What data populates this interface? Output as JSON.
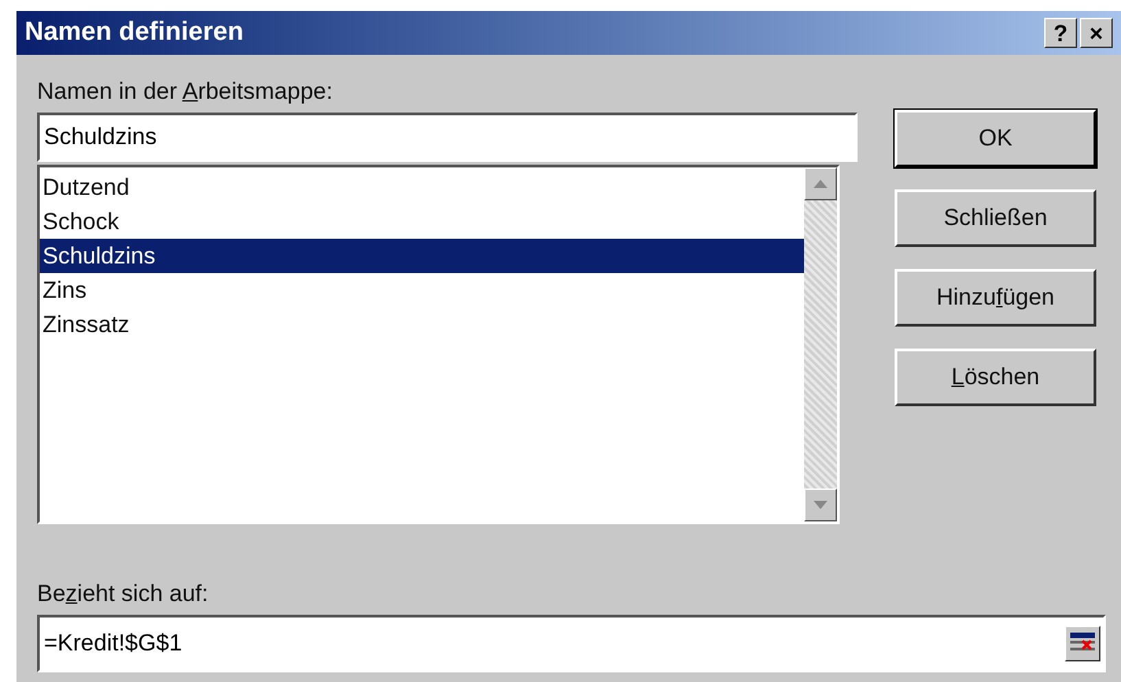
{
  "window": {
    "title": "Namen definieren",
    "title_buttons": [
      "?",
      "×"
    ]
  },
  "names_label": {
    "before": "Namen in der ",
    "key": "A",
    "after": "rbeitsmappe:"
  },
  "name_field": {
    "value": "Schuldzins"
  },
  "names_list": [
    {
      "label": "Dutzend",
      "selected": false
    },
    {
      "label": "Schock",
      "selected": false
    },
    {
      "label": "Schuldzins",
      "selected": true
    },
    {
      "label": "Zins",
      "selected": false
    },
    {
      "label": "Zinssatz",
      "selected": false
    }
  ],
  "buttons": [
    {
      "before": "OK",
      "default": true
    },
    {
      "before": "Schließen",
      "default": false
    },
    {
      "before": "Hinzu",
      "key": "f",
      "after": "ügen",
      "default": false
    },
    {
      "key": "L",
      "after": "öschen",
      "default": false
    }
  ],
  "refers_label": {
    "before": "Be",
    "key": "z",
    "after": "ieht sich auf:"
  },
  "refers_field": {
    "value": "=Kredit!$G$1"
  }
}
